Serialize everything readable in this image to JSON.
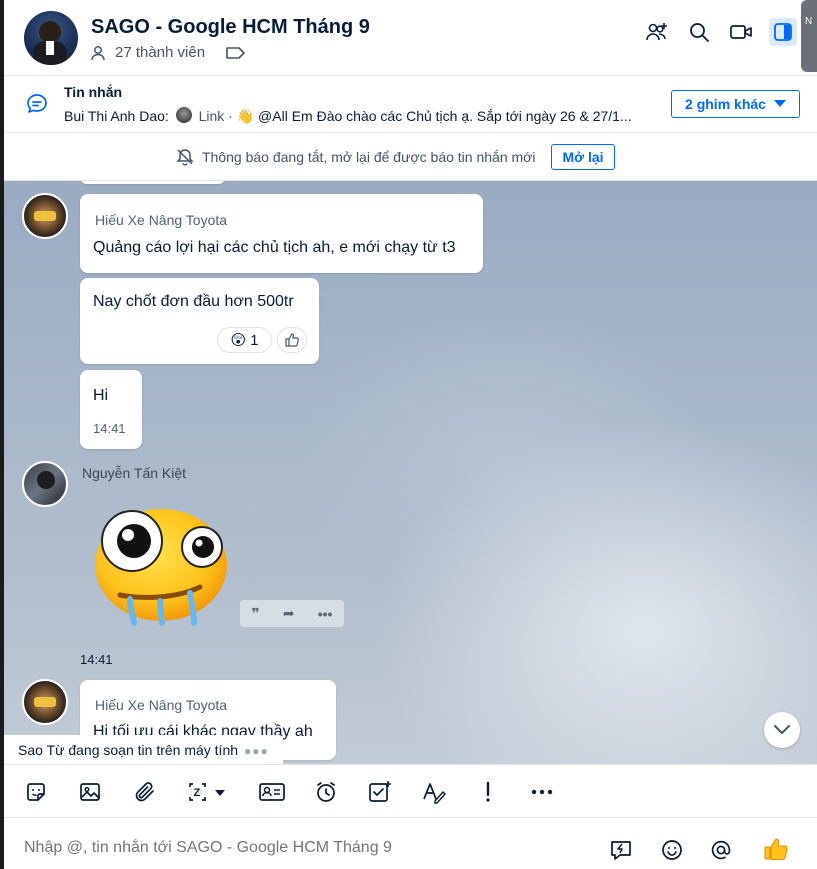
{
  "header": {
    "title": "SAGO - Google HCM Tháng 9",
    "members": "27 thành viên",
    "right_edge_text": "N"
  },
  "pinned": {
    "title": "Tin nhắn",
    "sender": "Bui Thi Anh Dao:",
    "link_text": "Link ·",
    "preview_text": "@All Em Đào chào các Chủ tịch ạ. Sắp tới ngày 26 & 27/1...",
    "more_button": "2 ghim khác"
  },
  "notification": {
    "text": "Thông báo đang tắt, mở lại để được báo tin nhắn mới",
    "button": "Mở lại"
  },
  "messages": [
    {
      "sender": "Hiếu Xe Nâng Toyota",
      "text": "Quảng cáo lợi hại các chủ tịch ah, e mới chạy từ t3"
    },
    {
      "text": "Nay chốt đơn đầu hơn 500tr",
      "reaction_count": "1"
    },
    {
      "text": "Hi",
      "time": "14:41"
    },
    {
      "sender": "Nguyễn Tấn Kiệt",
      "time": "14:41"
    },
    {
      "sender": "Hiếu Xe Nâng Toyota",
      "text": "Hi tối ưu cái khác ngay thầy ah"
    }
  ],
  "typing_indicator": "Sao Từ đang soạn tin trên máy tính",
  "composer": {
    "placeholder": "Nhập @, tin nhắn tới SAGO - Google HCM Tháng 9"
  },
  "icons": {
    "add_member": "add-member-icon",
    "search": "search-icon",
    "video": "video-call-icon",
    "sidebar": "sidebar-toggle-icon",
    "like": "thumbs-up-icon"
  }
}
